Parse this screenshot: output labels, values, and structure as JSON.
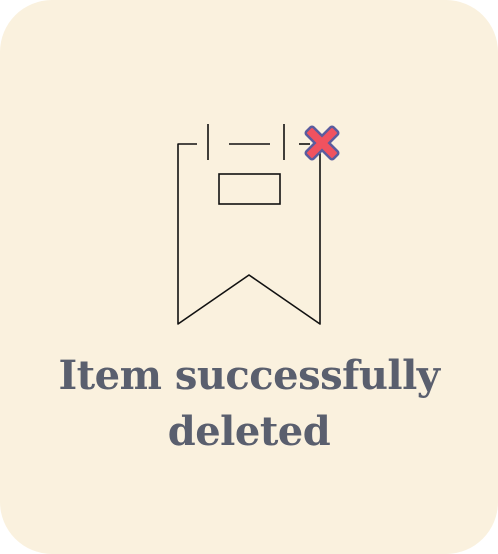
{
  "dialog": {
    "message": "Item successfully deleted",
    "illustration_icon": "bookmark-deleted-icon",
    "badge_icon": "close-x-icon"
  },
  "colors": {
    "card_background": "#faf1de",
    "text": "#5a5f6e",
    "badge_fill": "#f0525f",
    "badge_outline": "#5a5c9e",
    "line_art": "#111111"
  }
}
